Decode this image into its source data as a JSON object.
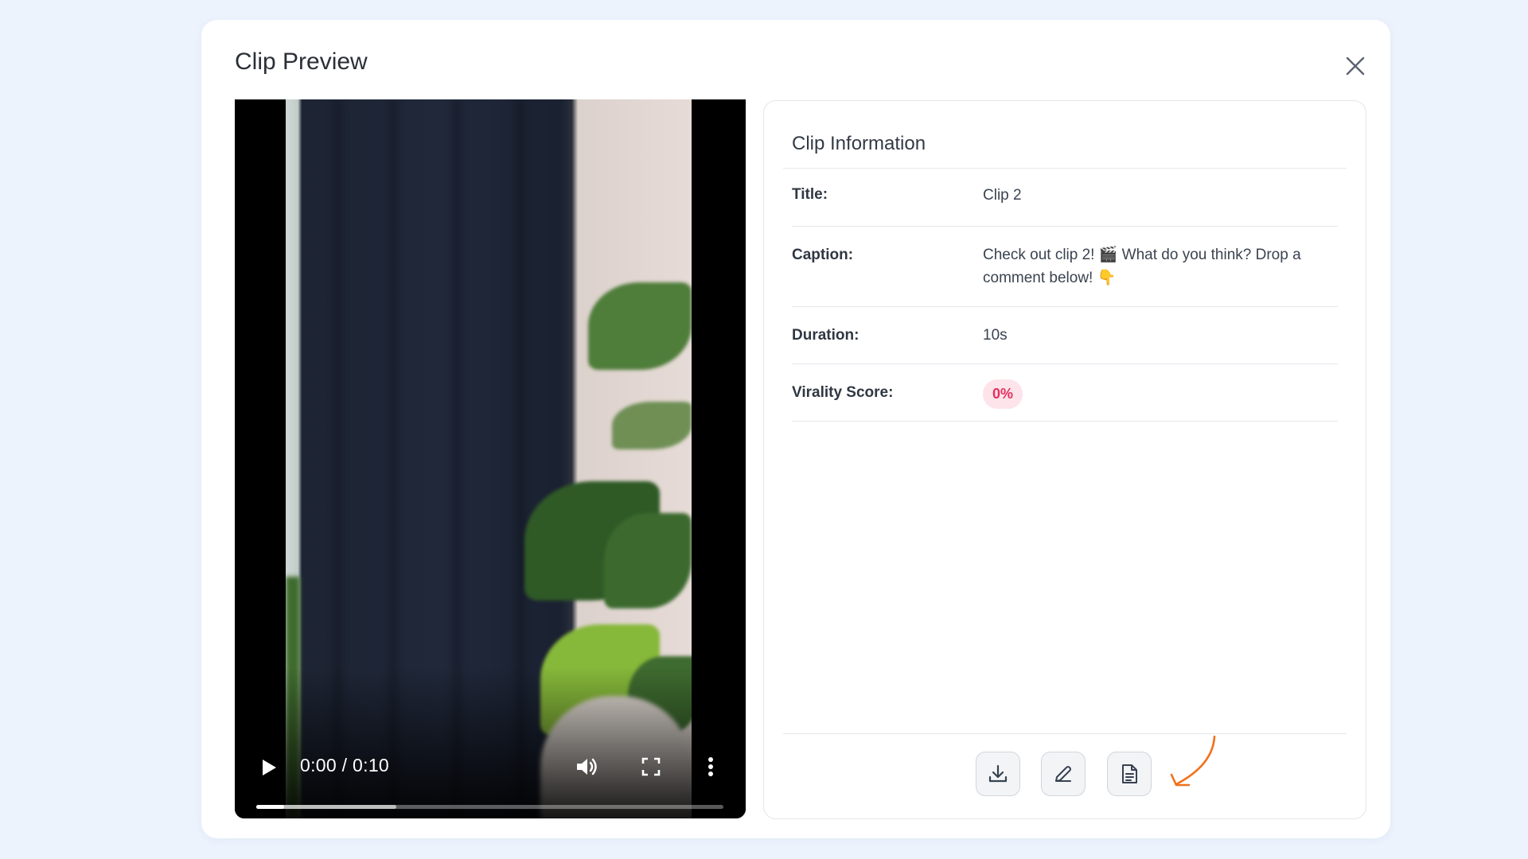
{
  "modal": {
    "title": "Clip Preview",
    "close_icon": "close-icon"
  },
  "player": {
    "time_display": "0:00 / 0:10",
    "progress_played": 0.06,
    "progress_buffered": 0.3,
    "icons": [
      "play-icon",
      "volume-icon",
      "fullscreen-icon",
      "more-vertical-icon"
    ]
  },
  "info": {
    "title": "Clip Information",
    "rows": [
      {
        "label": "Title:",
        "value": "Clip 2"
      },
      {
        "label": "Caption:",
        "value": "Check out clip 2! 🎬 What do you think? Drop a comment below! 👇"
      },
      {
        "label": "Duration:",
        "value": "10s"
      },
      {
        "label": "Virality Score:",
        "value": "0%"
      }
    ],
    "badge_colors": {
      "background": "#fde4ea",
      "text": "#e5305f"
    }
  },
  "actions": {
    "icons": [
      "download-icon",
      "edit-icon",
      "document-icon"
    ]
  },
  "annotation": {
    "arrow_color": "#f2711c"
  },
  "colors": {
    "page_background": "#edf3fd",
    "panel_border": "#e3e6ea"
  }
}
